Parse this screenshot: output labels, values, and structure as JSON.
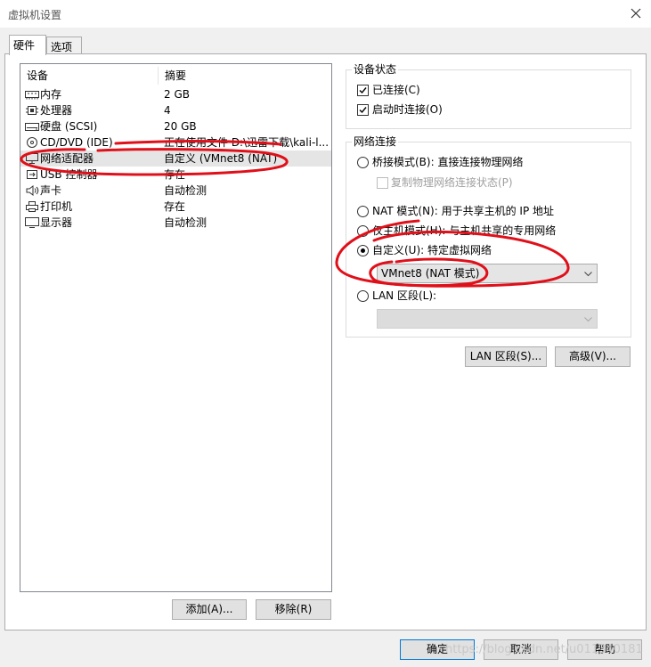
{
  "window": {
    "title": "虚拟机设置",
    "close_glyph": "✕"
  },
  "tabs": [
    {
      "label": "硬件"
    },
    {
      "label": "选项"
    }
  ],
  "device_list": {
    "headers": {
      "device": "设备",
      "summary": "摘要"
    },
    "rows": [
      {
        "name": "内存",
        "summary": "2 GB",
        "icon": "memory-icon"
      },
      {
        "name": "处理器",
        "summary": "4",
        "icon": "cpu-icon"
      },
      {
        "name": "硬盘 (SCSI)",
        "summary": "20 GB",
        "icon": "hard-disk-icon"
      },
      {
        "name": "CD/DVD (IDE)",
        "summary": "正在使用文件 D:\\迅雷下载\\kali-l...",
        "icon": "cd-dvd-icon"
      },
      {
        "name": "网络适配器",
        "summary": "自定义 (VMnet8 (NAT)",
        "icon": "network-adapter-icon",
        "selected": true
      },
      {
        "name": "USB 控制器",
        "summary": "存在",
        "icon": "usb-icon"
      },
      {
        "name": "声卡",
        "summary": "自动检测",
        "icon": "sound-card-icon"
      },
      {
        "name": "打印机",
        "summary": "存在",
        "icon": "printer-icon"
      },
      {
        "name": "显示器",
        "summary": "自动检测",
        "icon": "monitor-icon"
      }
    ]
  },
  "list_buttons": {
    "add": "添加(A)...",
    "remove": "移除(R)"
  },
  "device_status": {
    "title": "设备状态",
    "connected": {
      "label": "已连接(C)",
      "checked": true
    },
    "connect_at_power_on": {
      "label": "启动时连接(O)",
      "checked": true
    }
  },
  "network_connection": {
    "title": "网络连接",
    "bridged": {
      "label": "桥接模式(B): 直接连接物理网络",
      "checked": false
    },
    "replicate": {
      "label": "复制物理网络连接状态(P)",
      "checked": false,
      "disabled": true
    },
    "nat": {
      "label": "NAT 模式(N): 用于共享主机的 IP 地址",
      "checked": false
    },
    "host_only": {
      "label": "仅主机模式(H): 与主机共享的专用网络",
      "checked": false
    },
    "custom": {
      "label": "自定义(U): 特定虚拟网络",
      "checked": true
    },
    "custom_select": {
      "value": "VMnet8 (NAT 模式)"
    },
    "lan_segment": {
      "label": "LAN 区段(L):",
      "checked": false
    },
    "lan_select": {
      "value": ""
    }
  },
  "network_buttons": {
    "lan_segments": "LAN 区段(S)...",
    "advanced": "高级(V)..."
  },
  "dialog_buttons": {
    "ok": "确定",
    "cancel": "取消",
    "help": "帮助"
  },
  "watermark": "https://blog.csdn.net/u011340181",
  "colors": {
    "annotation": "#e0101a",
    "selected_row": "#e5e5e5",
    "default_button_border": "#0078d7"
  }
}
